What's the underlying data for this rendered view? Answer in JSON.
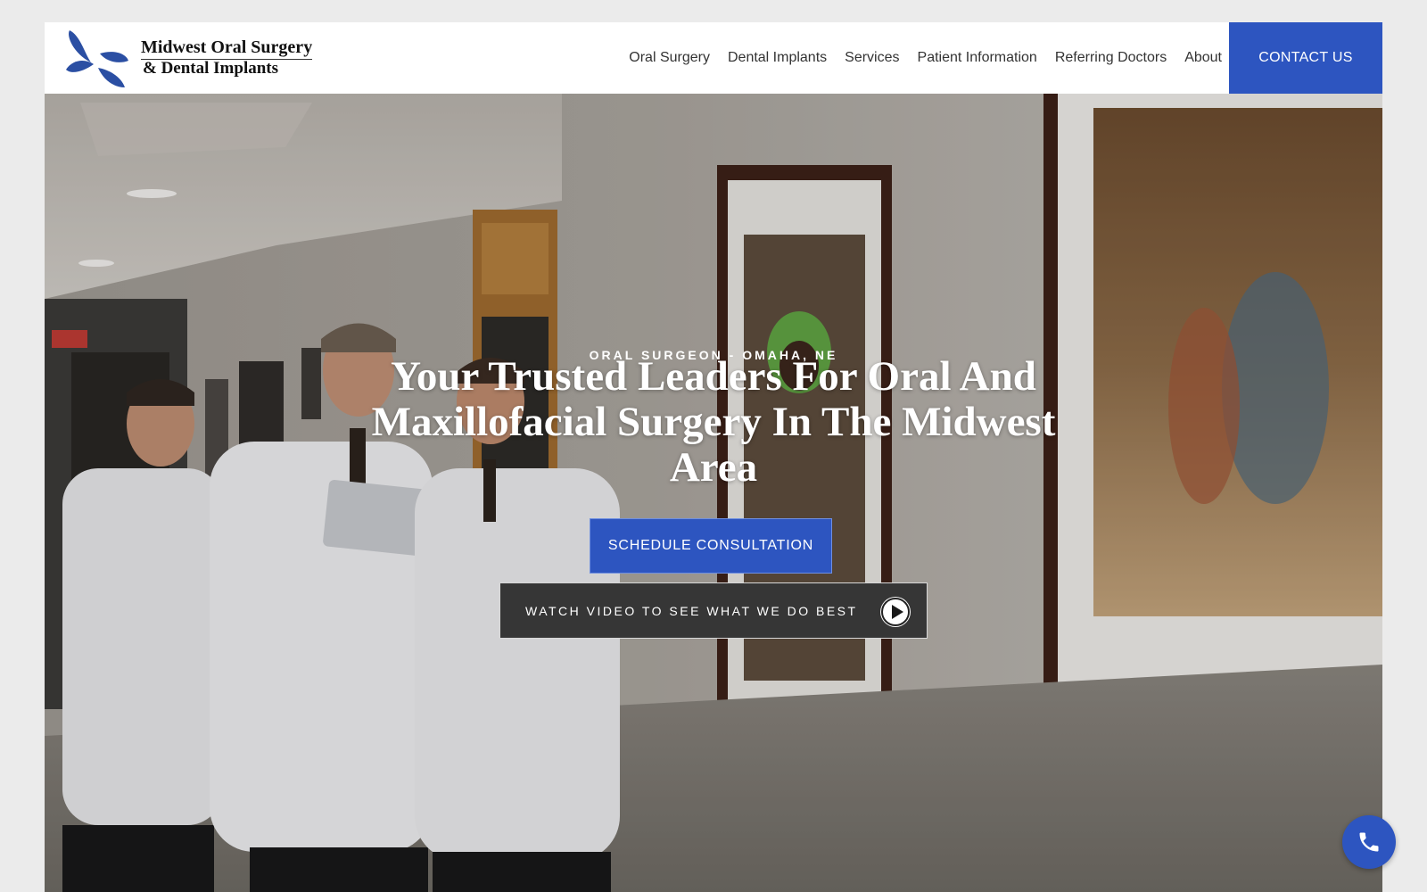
{
  "brand": {
    "name_line1": "Midwest Oral Surgery",
    "name_line2": "& Dental Implants",
    "accent_color": "#2d55c0",
    "logo_color": "#2b4fa3"
  },
  "nav": {
    "items": [
      {
        "label": "Oral Surgery"
      },
      {
        "label": "Dental Implants"
      },
      {
        "label": "Services"
      },
      {
        "label": "Patient Information"
      },
      {
        "label": "Referring Doctors"
      },
      {
        "label": "About"
      }
    ],
    "contact_label": "CONTACT US"
  },
  "hero": {
    "eyebrow": "ORAL SURGEON - OMAHA, NE",
    "headline": "Your Trusted Leaders For Oral And Maxillofacial Surgery In The Midwest Area",
    "schedule_label": "SCHEDULE CONSULTATION",
    "video_label": "WATCH VIDEO TO SEE WHAT WE DO BEST",
    "background": "photo of three surgeons in white coats walking down a hallway with framed photographs"
  },
  "floating": {
    "call_icon": "phone-icon"
  }
}
